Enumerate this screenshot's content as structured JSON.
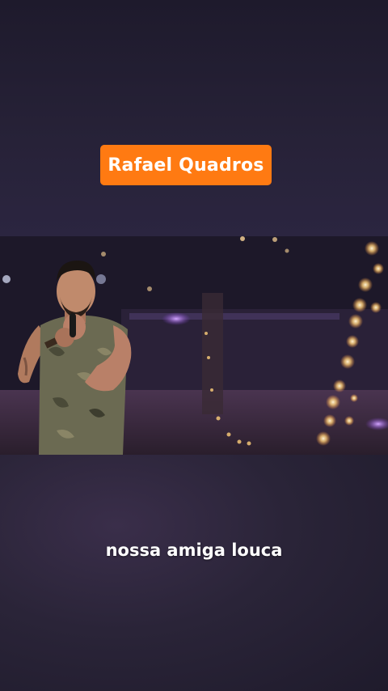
{
  "artist_badge": {
    "label": "Rafael Quadros",
    "color": "#ff7a12"
  },
  "video": {
    "icon": "video-frame"
  },
  "caption": {
    "text": "nossa amiga louca"
  }
}
